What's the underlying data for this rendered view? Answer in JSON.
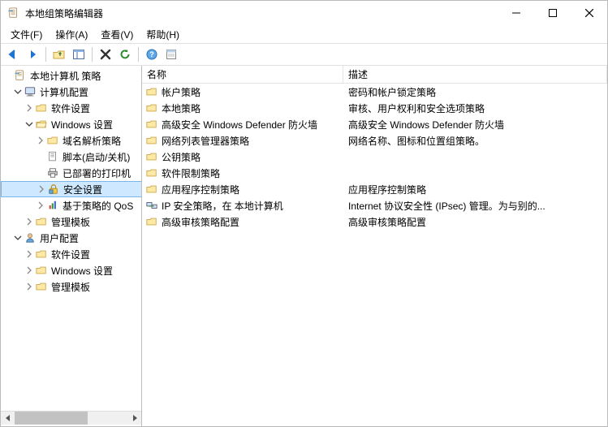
{
  "window": {
    "title": "本地组策略编辑器"
  },
  "menus": {
    "file": "文件(F)",
    "action": "操作(A)",
    "view": "查看(V)",
    "help": "帮助(H)"
  },
  "tree": {
    "root": "本地计算机 策略",
    "computer": "计算机配置",
    "computer_software": "软件设置",
    "computer_windows": "Windows 设置",
    "nrp": "域名解析策略",
    "scripts": "脚本(启动/关机)",
    "printers": "已部署的打印机",
    "security": "安全设置",
    "qos": "基于策略的 QoS",
    "computer_admin": "管理模板",
    "user": "用户配置",
    "user_software": "软件设置",
    "user_windows": "Windows 设置",
    "user_admin": "管理模板"
  },
  "columns": {
    "name": "名称",
    "desc": "描述"
  },
  "rows": [
    {
      "name": "帐户策略",
      "desc": "密码和帐户锁定策略",
      "icon": "folder"
    },
    {
      "name": "本地策略",
      "desc": "审核、用户权利和安全选项策略",
      "icon": "folder"
    },
    {
      "name": "高级安全 Windows Defender 防火墙",
      "desc": "高级安全 Windows Defender 防火墙",
      "icon": "folder"
    },
    {
      "name": "网络列表管理器策略",
      "desc": "网络名称、图标和位置组策略。",
      "icon": "folder"
    },
    {
      "name": "公钥策略",
      "desc": "",
      "icon": "folder"
    },
    {
      "name": "软件限制策略",
      "desc": "",
      "icon": "folder"
    },
    {
      "name": "应用程序控制策略",
      "desc": "应用程序控制策略",
      "icon": "folder"
    },
    {
      "name": "IP 安全策略，在 本地计算机",
      "desc": "Internet 协议安全性 (IPsec) 管理。为与别的...",
      "icon": "ipsec"
    },
    {
      "name": "高级审核策略配置",
      "desc": "高级审核策略配置",
      "icon": "folder"
    }
  ]
}
